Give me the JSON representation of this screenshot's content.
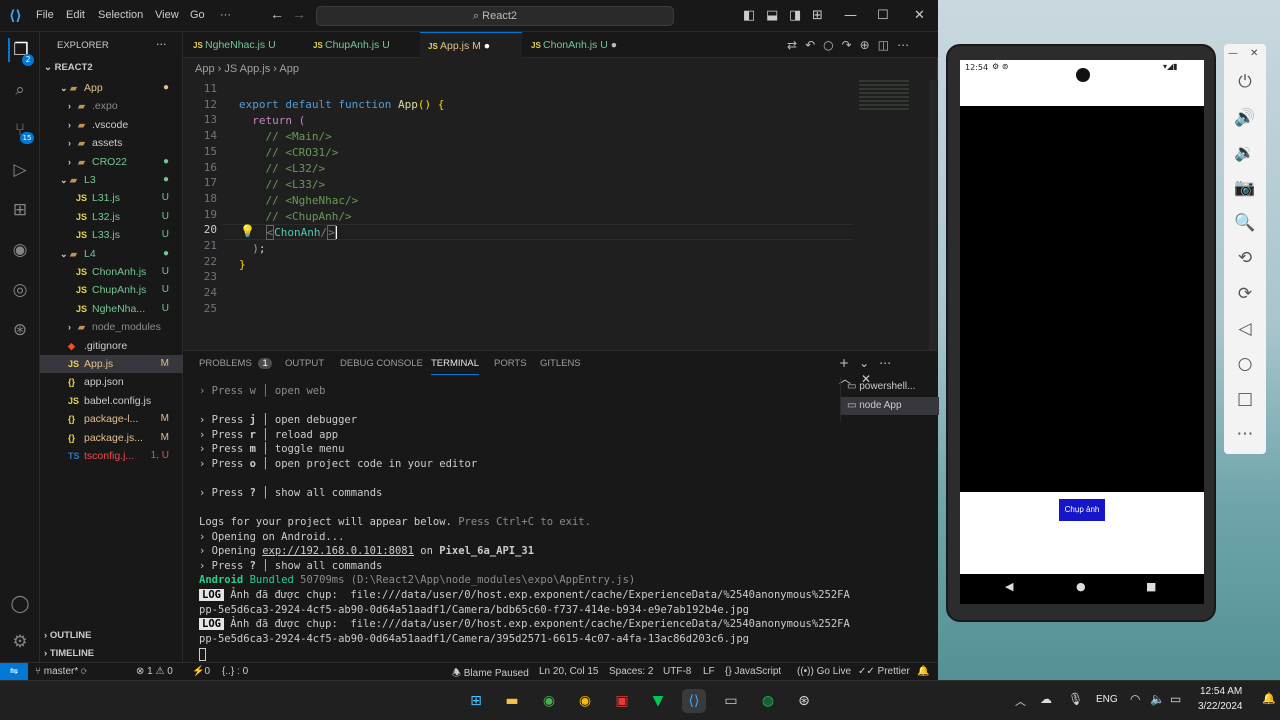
{
  "titlebar": {
    "menu": [
      "File",
      "Edit",
      "Selection",
      "View",
      "Go"
    ],
    "more": "···",
    "search": "React2"
  },
  "explorer": {
    "header": "EXPLORER",
    "more": "···",
    "root": "REACT2",
    "outline": "OUTLINE",
    "timeline": "TIMELINE",
    "items": [
      {
        "label": "App",
        "status": "●",
        "color": "#e2c08d"
      },
      {
        "label": ".expo",
        "status": "",
        "color": "#8b8b8b"
      },
      {
        "label": ".vscode",
        "status": "",
        "color": "#cccccc"
      },
      {
        "label": "assets",
        "status": "",
        "color": "#cccccc"
      },
      {
        "label": "CRO22",
        "status": "●",
        "color": "#73c991"
      },
      {
        "label": "L3",
        "status": "●",
        "color": "#73c991"
      },
      {
        "label": "L31.js",
        "status": "U",
        "color": "#73c991"
      },
      {
        "label": "L32.js",
        "status": "U",
        "color": "#73c991"
      },
      {
        "label": "L33.js",
        "status": "U",
        "color": "#73c991"
      },
      {
        "label": "L4",
        "status": "●",
        "color": "#73c991"
      },
      {
        "label": "ChonAnh.js",
        "status": "U",
        "color": "#73c991"
      },
      {
        "label": "ChupAnh.js",
        "status": "U",
        "color": "#73c991"
      },
      {
        "label": "NgheNha...",
        "status": "U",
        "color": "#73c991"
      },
      {
        "label": "node_modules",
        "status": "",
        "color": "#8b8b8b"
      },
      {
        "label": ".gitignore",
        "status": "",
        "color": "#cccccc"
      },
      {
        "label": "App.js",
        "status": "M",
        "color": "#e2c08d"
      },
      {
        "label": "app.json",
        "status": "",
        "color": "#cccccc"
      },
      {
        "label": "babel.config.js",
        "status": "",
        "color": "#cccccc"
      },
      {
        "label": "package-l...",
        "status": "M",
        "color": "#e2c08d"
      },
      {
        "label": "package.js...",
        "status": "M",
        "color": "#e2c08d"
      },
      {
        "label": "tsconfig.j...",
        "status": "1, U",
        "color": "#f14c4c"
      }
    ]
  },
  "tabs": [
    {
      "label": "NgheNhac.js",
      "status": "U"
    },
    {
      "label": "ChupAnh.js",
      "status": "U"
    },
    {
      "label": "App.js",
      "status": "M"
    },
    {
      "label": "ChonAnh.js",
      "status": "U"
    }
  ],
  "breadcrumb": [
    "App",
    "JS App.js",
    "App"
  ],
  "editor": {
    "line_numbers": [
      "11",
      "12",
      "13",
      "14",
      "15",
      "16",
      "17",
      "18",
      "19",
      "20",
      "21",
      "22",
      "23",
      "24",
      "25"
    ]
  },
  "panel": {
    "tabs": [
      "PROBLEMS",
      "OUTPUT",
      "DEBUG CONSOLE",
      "TERMINAL",
      "PORTS",
      "GITLENS"
    ],
    "problems_count": "1",
    "terminals": [
      "powershell...",
      "node  App"
    ]
  },
  "terminal": {
    "l0": "› Press w │ open web",
    "k1": "j",
    "t1": "open debugger",
    "k2": "r",
    "t2": "reload app",
    "k3": "m",
    "t3": "toggle menu",
    "k4": "o",
    "t4": "open project code in your editor",
    "k5": "?",
    "t5": "show all commands",
    "logs": "Logs for your project will appear below.",
    "logs_hint": "Press Ctrl+C to exit.",
    "opening": "› Opening on Android...",
    "opening2a": "› Opening ",
    "url": "exp://192.168.0.101:8081",
    "opening2b": " on ",
    "device": "Pixel_6a_API_31",
    "k6": "?",
    "t6": "show all commands",
    "bundled_a": "Android",
    "bundled_b": " Bundled ",
    "bundled_c": "50709ms (D:\\React2\\App\\node_modules\\expo\\AppEntry.js)",
    "log1a": "Ảnh đã được chụp:  file:///data/user/0/host.exp.exponent/cache/ExperienceData/%2540anonymous%252FA",
    "log1b": "pp-5e5d6ca3-2924-4cf5-ab90-0d64a51aadf1/Camera/bdb65c60-f737-414e-b934-e9e7ab192b4e.jpg",
    "log2a": "Ảnh đã được chụp:  file:///data/user/0/host.exp.exponent/cache/ExperienceData/%2540anonymous%252FA",
    "log2b": "pp-5e5d6ca3-2924-4cf5-ab90-0d64a51aadf1/Camera/395d2571-6615-4c07-a4fa-13ac86d203c6.jpg",
    "log_tag": "LOG",
    "press": "Press"
  },
  "statusbar": {
    "branch": "master*",
    "errors": "⊗ 1 ⚠ 0",
    "ports": "⚡0",
    "braces": "{..} : 0",
    "blame": "Blame Paused",
    "cursor": "Ln 20, Col 15",
    "spaces": "Spaces: 2",
    "encoding": "UTF-8",
    "eol": "LF",
    "language": "JavaScript",
    "golive": "Go Live",
    "prettier": "✓✓ Prettier"
  },
  "phone": {
    "time": "12:54",
    "button": "Chụp ảnh"
  },
  "taskbar": {
    "lang": "ENG",
    "time": "12:54 AM",
    "date": "3/22/2024"
  },
  "colors": {
    "accent": "#0078d4",
    "phone_button": "#1515c9"
  }
}
